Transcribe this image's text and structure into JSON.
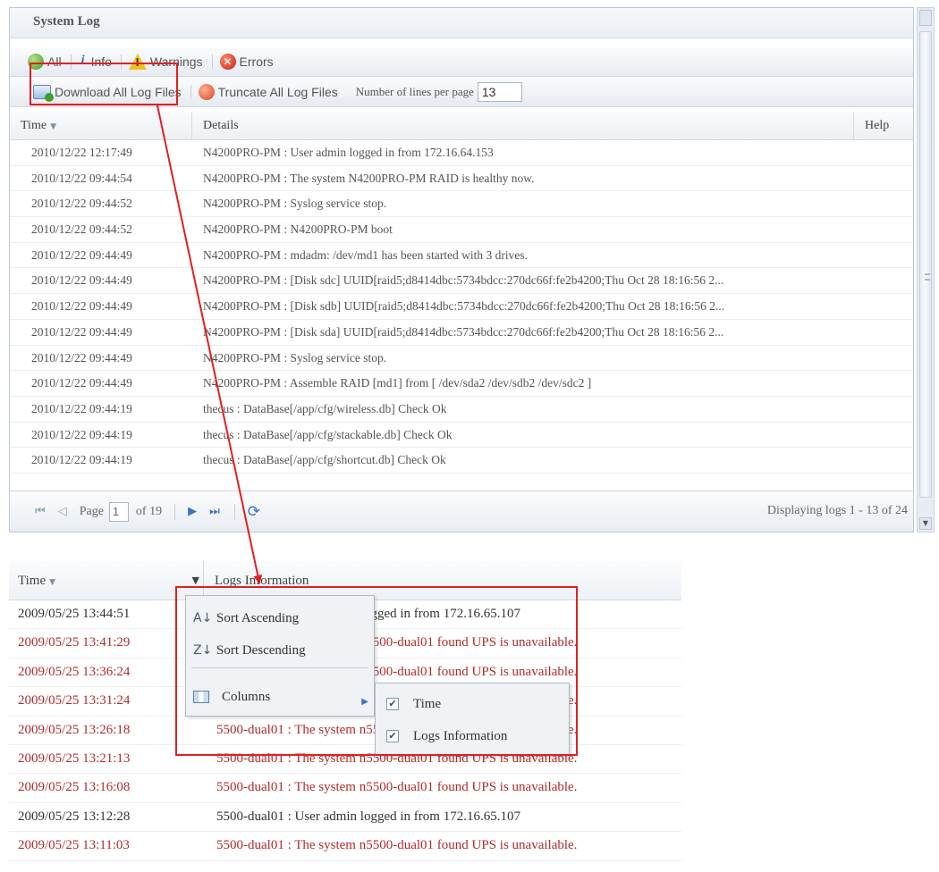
{
  "system_log": {
    "title": "System Log",
    "filters": {
      "all": "All",
      "info": "Info",
      "warnings": "Warnings",
      "errors": "Errors"
    },
    "actions": {
      "download": "Download All Log Files",
      "truncate": "Truncate All Log Files",
      "lines_label": "Number of lines per page",
      "lines_value": "13"
    },
    "columns": {
      "time": "Time",
      "details": "Details",
      "help": "Help"
    },
    "rows": [
      {
        "time": "2010/12/22 12:17:49",
        "details": "N4200PRO-PM : User admin logged in from 172.16.64.153"
      },
      {
        "time": "2010/12/22 09:44:54",
        "details": "N4200PRO-PM : The system N4200PRO-PM RAID is healthy now."
      },
      {
        "time": "2010/12/22 09:44:52",
        "details": "N4200PRO-PM : Syslog service stop."
      },
      {
        "time": "2010/12/22 09:44:52",
        "details": "N4200PRO-PM : N4200PRO-PM boot"
      },
      {
        "time": "2010/12/22 09:44:49",
        "details": "N4200PRO-PM : mdadm: /dev/md1 has been started with 3 drives."
      },
      {
        "time": "2010/12/22 09:44:49",
        "details": "N4200PRO-PM : [Disk sdc] UUID[raid5;d8414dbc:5734bdcc:270dc66f:fe2b4200;Thu Oct 28 18:16:56 2..."
      },
      {
        "time": "2010/12/22 09:44:49",
        "details": "N4200PRO-PM : [Disk sdb] UUID[raid5;d8414dbc:5734bdcc:270dc66f:fe2b4200;Thu Oct 28 18:16:56 2..."
      },
      {
        "time": "2010/12/22 09:44:49",
        "details": "N4200PRO-PM : [Disk sda] UUID[raid5;d8414dbc:5734bdcc:270dc66f:fe2b4200;Thu Oct 28 18:16:56 2..."
      },
      {
        "time": "2010/12/22 09:44:49",
        "details": "N4200PRO-PM : Syslog service stop."
      },
      {
        "time": "2010/12/22 09:44:49",
        "details": "N4200PRO-PM : Assemble RAID [md1] from [ /dev/sda2 /dev/sdb2 /dev/sdc2 ]"
      },
      {
        "time": "2010/12/22 09:44:19",
        "details": "thecus : DataBase[/app/cfg/wireless.db] Check Ok"
      },
      {
        "time": "2010/12/22 09:44:19",
        "details": "thecus : DataBase[/app/cfg/stackable.db] Check Ok"
      },
      {
        "time": "2010/12/22 09:44:19",
        "details": "thecus : DataBase[/app/cfg/shortcut.db] Check Ok"
      }
    ],
    "pager": {
      "page_label": "Page",
      "page_value": "1",
      "of_label": "of 19",
      "display": "Displaying logs 1 - 13 of 24"
    }
  },
  "column_menu_demo": {
    "columns": {
      "time": "Time",
      "info": "Logs Information"
    },
    "menu": {
      "sort_asc": "Sort Ascending",
      "sort_desc": "Sort Descending",
      "columns": "Columns"
    },
    "submenu": {
      "time": "Time",
      "info": "Logs Information"
    },
    "rows": [
      {
        "time": "2009/05/25 13:44:51",
        "info": "5500-dual01 : User admin logged in from 172.16.65.107",
        "severity": "info"
      },
      {
        "time": "2009/05/25 13:41:29",
        "info": "5500-dual01 : The system n5500-dual01 found UPS is unavailable.",
        "severity": "error"
      },
      {
        "time": "2009/05/25 13:36:24",
        "info": "5500-dual01 : The system n5500-dual01 found UPS is unavailable.",
        "severity": "error"
      },
      {
        "time": "2009/05/25 13:31:24",
        "info": "5500-dual01 : The system n5500-dual01 found UPS is unavailable.",
        "severity": "error"
      },
      {
        "time": "2009/05/25 13:26:18",
        "info": "5500-dual01 : The system n5500-dual01 found UPS is unavailable.",
        "severity": "error"
      },
      {
        "time": "2009/05/25 13:21:13",
        "info": "5500-dual01 : The system n5500-dual01 found UPS is unavailable.",
        "severity": "error"
      },
      {
        "time": "2009/05/25 13:16:08",
        "info": "5500-dual01 : The system n5500-dual01 found UPS is unavailable.",
        "severity": "error"
      },
      {
        "time": "2009/05/25 13:12:28",
        "info": "5500-dual01 : User admin logged in from 172.16.65.107",
        "severity": "info"
      },
      {
        "time": "2009/05/25 13:11:03",
        "info": "5500-dual01 : The system n5500-dual01 found UPS is unavailable.",
        "severity": "error"
      }
    ]
  },
  "colors": {
    "annotation": "#e02020",
    "error_text": "#b22b2b",
    "link_blue": "#3a72c6"
  }
}
